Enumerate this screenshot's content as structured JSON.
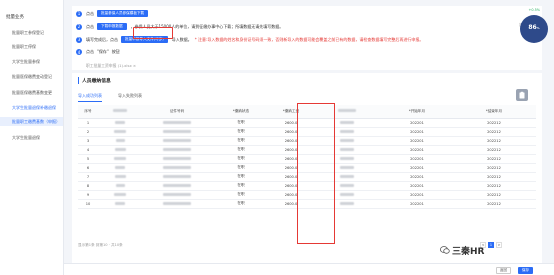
{
  "sidebar": {
    "title": "批量业务",
    "items": [
      "批量职工参保登记",
      "批量职工停保",
      "大学生批量参保",
      "批量医保缴费变动登记",
      "批量医保缴费基数变更",
      "大学生批量退保补缴退保",
      "批量职工缴费基数（申报）",
      "大学生批量退保"
    ]
  },
  "steps": {
    "step1": {
      "num": "1",
      "prefix": "点击",
      "button": "批量参保人员参保模板下载"
    },
    "step2": {
      "num": "2",
      "prefix": "点击",
      "button": "下载申报数据",
      "text": "，参保人员大于15000人的单位，请到征缴办事中心下载；所填数据无请先填写数据。"
    },
    "step3": {
      "num": "3",
      "prefix": "填写完成后，点击",
      "button": "批量申报导入文件(可多)",
      "text": "导入数据。",
      "warning": "* 注意:导入数据的姓名和身份证号码须一致，否则新导入的数据可能会覆盖之前已有的数据，请检查数据填写完整后再进行申报。"
    },
    "step4": {
      "num": "4",
      "prefix": "点击",
      "quote": "\"保存\"",
      "suffix": "按钮"
    },
    "file": "职工批量工资申报 (1).xlsx ×"
  },
  "gauge": {
    "value": "86",
    "unit": "%",
    "label1": "+0.5%",
    "label2": "操作"
  },
  "panel": {
    "title": "人员缴纳信息",
    "tabs": {
      "active": "导入成功列表",
      "inactive": "导入失败列表"
    },
    "columns": [
      "序号",
      "",
      "证件号码",
      "*缴纳状态",
      "*缴纳工资",
      "",
      "*开始年月",
      "*结束年月"
    ],
    "rows": [
      {
        "no": "1",
        "status": "在职",
        "wage": "2600.0",
        "start": "202201",
        "end": "202212"
      },
      {
        "no": "2",
        "status": "在职",
        "wage": "2600.0",
        "start": "202201",
        "end": "202212"
      },
      {
        "no": "3",
        "status": "在职",
        "wage": "2600.0",
        "start": "202201",
        "end": "202212"
      },
      {
        "no": "4",
        "status": "在职",
        "wage": "2600.0",
        "start": "202201",
        "end": "202212"
      },
      {
        "no": "5",
        "status": "在职",
        "wage": "2600.0",
        "start": "202201",
        "end": "202212"
      },
      {
        "no": "6",
        "status": "在职",
        "wage": "2600.0",
        "start": "202201",
        "end": "202212"
      },
      {
        "no": "7",
        "status": "在职",
        "wage": "2600.0",
        "start": "202201",
        "end": "202212"
      },
      {
        "no": "8",
        "status": "在职",
        "wage": "2600.0",
        "start": "202201",
        "end": "202212"
      },
      {
        "no": "9",
        "status": "在职",
        "wage": "2600.0",
        "start": "202201",
        "end": "202212"
      },
      {
        "no": "10",
        "status": "在职",
        "wage": "2600.0",
        "start": "202201",
        "end": "202212"
      }
    ],
    "footer": "显示第1条 到第10 · 共10条",
    "pager": [
      "<",
      "1",
      ">"
    ]
  },
  "bottom": {
    "back": "返回",
    "save": "保存"
  },
  "watermark": "三秦HR"
}
